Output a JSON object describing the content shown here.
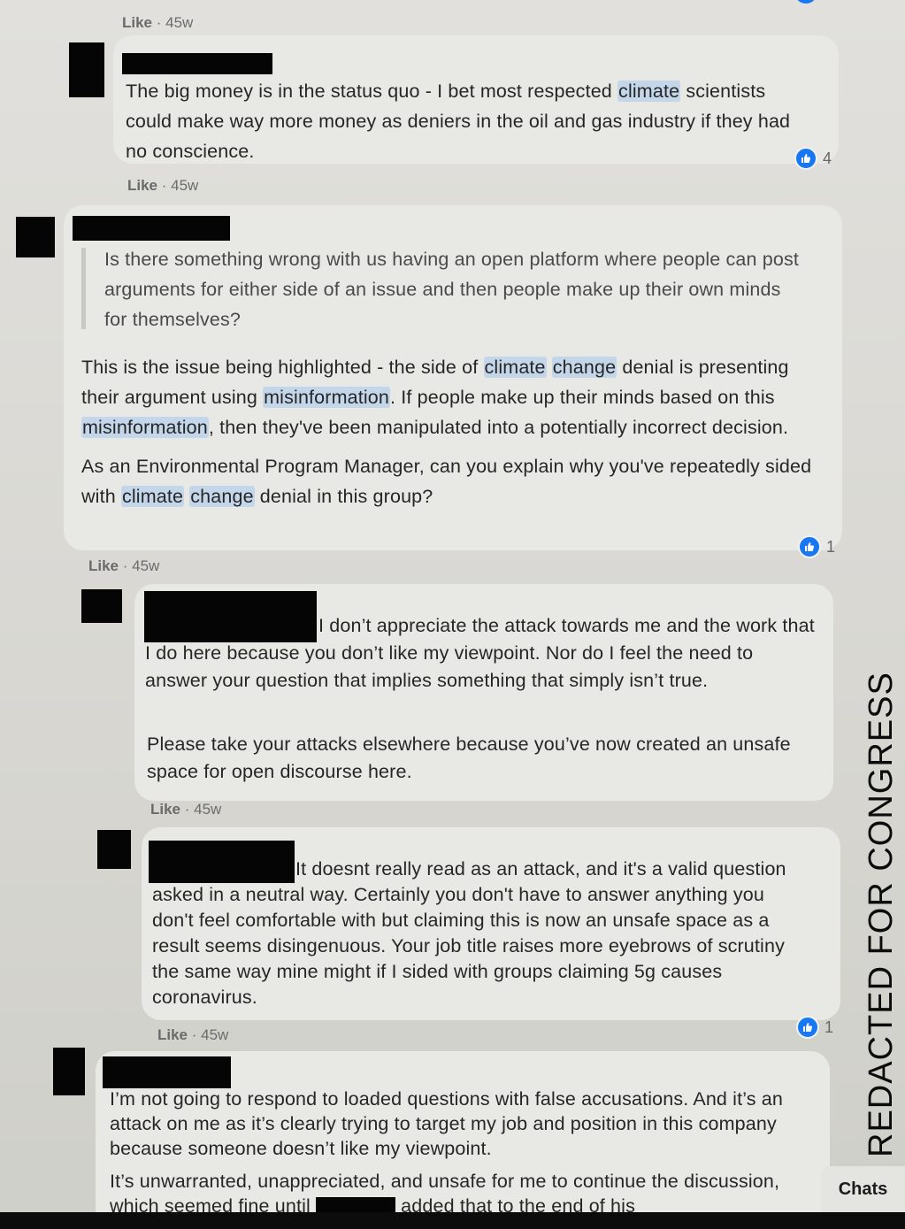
{
  "watermark": "REDACTED FOR CONGRESS",
  "chats_label": "Chats",
  "like_label": "Like",
  "comments": [
    {
      "id": "c0",
      "meta_time": "45w"
    },
    {
      "id": "c1",
      "paragraphs": [
        [
          "The big money is in the status quo - I bet most respected ",
          {
            "hl": "climate"
          },
          " scientists could make way more money as deniers in the oil and gas industry if they had no conscience."
        ]
      ],
      "reaction_count": "4",
      "meta_time": "45w"
    },
    {
      "id": "c2",
      "quote": "Is there something wrong with us having an open platform where people can post arguments for either side of an issue and then people make up their own minds for themselves?",
      "paragraphs": [
        [
          "This is the issue being highlighted - the side of ",
          {
            "hl": "climate"
          },
          " ",
          {
            "hl": "change"
          },
          " denial is presenting their argument using ",
          {
            "hl": "misinformation"
          },
          ". If people make up their minds based on this ",
          {
            "hl": "misinformation"
          },
          ", then they've been manipulated into a potentially incorrect decision."
        ],
        [
          "As an Environmental Program Manager, can you explain why you've repeatedly sided with ",
          {
            "hl": "climate"
          },
          " ",
          {
            "hl": "change"
          },
          " denial in this group?"
        ]
      ],
      "reaction_count": "1",
      "meta_time": "45w"
    },
    {
      "id": "c3",
      "paragraphs": [
        [
          "I don’t appreciate the attack towards me and the work that I do here because you don’t like my viewpoint. Nor do I feel the need to answer your question that implies something that simply isn’t true."
        ],
        [
          "Please take your attacks elsewhere because you’ve now created an unsafe space for open discourse here."
        ]
      ],
      "meta_time": "45w"
    },
    {
      "id": "c4",
      "paragraphs": [
        [
          "It doesnt really read as an attack, and it's a valid question asked in a neutral way. Certainly you don't have to answer anything you don't feel comfortable with but claiming this is now an unsafe space as a result seems disingenuous. Your job title raises more eyebrows of scrutiny the same way mine might if I sided with groups claiming 5g causes coronavirus."
        ]
      ],
      "reaction_count": "1",
      "meta_time": "45w"
    },
    {
      "id": "c5",
      "paragraphs": [
        [
          "I’m not going to respond to loaded questions with false accusations. And it’s an attack on me as it’s clearly trying to target my job and position in this company because someone doesn’t like my viewpoint."
        ],
        [
          "It’s unwarranted, unappreciated, and unsafe for me to continue the discussion, which seemed fine until ",
          {
            "redact": true
          },
          " added that to the end of his"
        ]
      ]
    }
  ]
}
